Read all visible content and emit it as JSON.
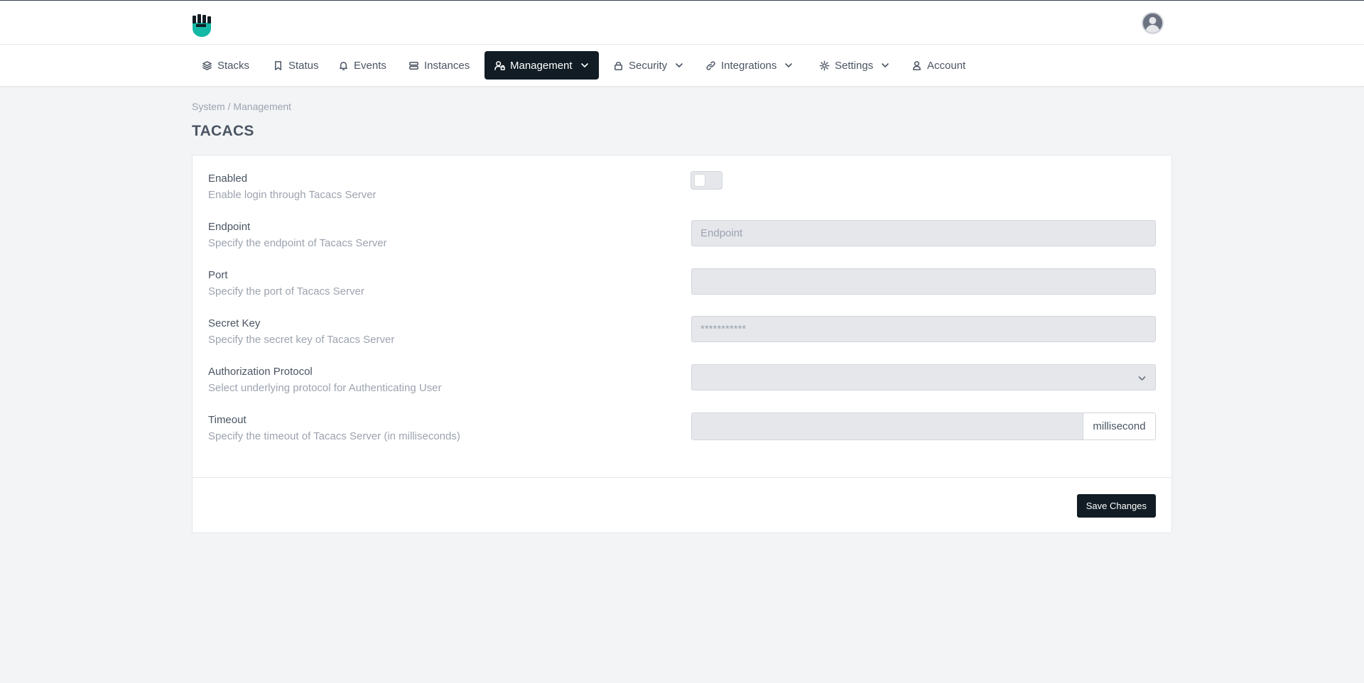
{
  "nav": {
    "items": [
      {
        "label": "Stacks"
      },
      {
        "label": "Status"
      },
      {
        "label": "Events"
      },
      {
        "label": "Instances"
      },
      {
        "label": "Management",
        "active": true
      },
      {
        "label": "Security"
      },
      {
        "label": "Integrations"
      },
      {
        "label": "Settings"
      },
      {
        "label": "Account"
      }
    ]
  },
  "breadcrumb": "System / Management",
  "page_title": "TACACS",
  "form": {
    "enabled": {
      "label": "Enabled",
      "description": "Enable login through Tacacs Server",
      "value": false
    },
    "endpoint": {
      "label": "Endpoint",
      "description": "Specify the endpoint of Tacacs Server",
      "placeholder": "Endpoint",
      "value": ""
    },
    "port": {
      "label": "Port",
      "description": "Specify the port of Tacacs Server",
      "value": ""
    },
    "secret_key": {
      "label": "Secret Key",
      "description": "Specify the secret key of Tacacs Server",
      "placeholder": "***********",
      "value": ""
    },
    "auth_protocol": {
      "label": "Authorization Protocol",
      "description": "Select underlying protocol for Authenticating User",
      "value": ""
    },
    "timeout": {
      "label": "Timeout",
      "description": "Specify the timeout of Tacacs Server (in milliseconds)",
      "unit": "millisecond",
      "value": ""
    }
  },
  "save_label": "Save Changes",
  "colors": {
    "brand": "#14b8a6",
    "dark": "#111c24",
    "background": "#f3f4f6"
  }
}
